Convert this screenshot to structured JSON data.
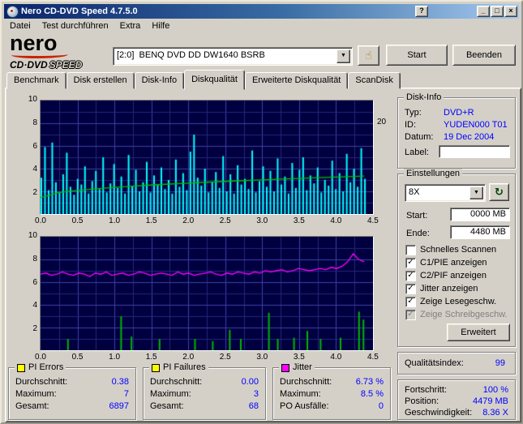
{
  "window": {
    "title": "Nero CD-DVD Speed 4.7.5.0",
    "controls": {
      "help": "?",
      "minimize": "_",
      "maximize": "□",
      "close": "×"
    }
  },
  "menu": {
    "items": [
      "Datei",
      "Test durchführen",
      "Extra",
      "Hilfe"
    ]
  },
  "logo": {
    "brand": "nero",
    "product_left": "CD·DVD",
    "product_right": "SPEED"
  },
  "toolbar": {
    "drive": "[2:0]  BENQ DVD DD DW1640 BSRB",
    "start": "Start",
    "quit": "Beenden"
  },
  "tabs": {
    "items": [
      "Benchmark",
      "Disk erstellen",
      "Disk-Info",
      "Diskqualität",
      "Erweiterte Diskqualität",
      "ScanDisk"
    ],
    "active_index": 3
  },
  "charts": {
    "left_ticks": [
      "10",
      "8",
      "6",
      "4",
      "2"
    ],
    "x_ticks": [
      "0.0",
      "0.5",
      "1.0",
      "1.5",
      "2.0",
      "2.5",
      "3.0",
      "3.5",
      "4.0",
      "4.5"
    ],
    "right_tick": "20",
    "bg": "#000040",
    "grid_minor": "#26267a",
    "grid_major": "#3f3fa8"
  },
  "disk_info": {
    "title": "Disk-Info",
    "rows": [
      {
        "label": "Typ:",
        "value": "DVD+R"
      },
      {
        "label": "ID:",
        "value": "YUDEN000 T01"
      },
      {
        "label": "Datum:",
        "value": "19 Dec 2004"
      }
    ],
    "label_caption": "Label:",
    "label_value": ""
  },
  "settings": {
    "title": "Einstellungen",
    "speed": "8X",
    "start_label": "Start:",
    "start_value": "0000 MB",
    "end_label": "Ende:",
    "end_value": "4480 MB",
    "checkboxes": [
      {
        "label": "Schnelles Scannen",
        "checked": false,
        "enabled": true
      },
      {
        "label": "C1/PIE anzeigen",
        "checked": true,
        "enabled": true
      },
      {
        "label": "C2/PIF anzeigen",
        "checked": true,
        "enabled": true
      },
      {
        "label": "Jitter anzeigen",
        "checked": true,
        "enabled": true
      },
      {
        "label": "Zeige Lesegeschw.",
        "checked": true,
        "enabled": true
      },
      {
        "label": "Zeige Schreibgeschw.",
        "checked": true,
        "enabled": false
      }
    ],
    "advanced_label": "Erweitert"
  },
  "quality": {
    "label": "Qualitätsindex:",
    "value": "99"
  },
  "progress": {
    "rows": [
      {
        "label": "Fortschritt:",
        "value": "100 %"
      },
      {
        "label": "Position:",
        "value": "4479 MB"
      },
      {
        "label": "Geschwindigkeit:",
        "value": "8.36 X"
      }
    ]
  },
  "stats": [
    {
      "title": "PI Errors",
      "color": "#ffff00",
      "rows": [
        [
          "Durchschnitt:",
          "0.38"
        ],
        [
          "Maximum:",
          "7"
        ],
        [
          "Gesamt:",
          "6897"
        ]
      ]
    },
    {
      "title": "PI Failures",
      "color": "#ffff00",
      "rows": [
        [
          "Durchschnitt:",
          "0.00"
        ],
        [
          "Maximum:",
          "3"
        ],
        [
          "Gesamt:",
          "68"
        ]
      ]
    },
    {
      "title": "Jitter",
      "color": "#ff00ff",
      "rows": [
        [
          "Durchschnitt:",
          "6.73 %"
        ],
        [
          "Maximum:",
          "8.5 %"
        ],
        [
          "PO Ausfälle:",
          "0"
        ]
      ]
    }
  ],
  "chart_data": [
    {
      "type": "bar",
      "series": "PI Errors",
      "x_unit": "GB",
      "x_range": [
        0,
        4.5
      ],
      "x_end": 4.38,
      "y_range": [
        0,
        10
      ],
      "bar_color": "#00ffff",
      "values": [
        3.2,
        5.9,
        2.1,
        6.3,
        2.8,
        1.9,
        3.5,
        5.4,
        2.4,
        1.7,
        3.1,
        2.6,
        4.2,
        1.8,
        2.9,
        3.8,
        2.2,
        5.0,
        1.9,
        2.7,
        4.4,
        2.3,
        3.3,
        1.8,
        5.2,
        2.5,
        3.9,
        2.0,
        2.8,
        4.6,
        1.9,
        3.4,
        2.6,
        4.1,
        2.2,
        3.0,
        1.8,
        4.8,
        2.4,
        3.6,
        2.1,
        5.5,
        7.0,
        3.2,
        2.5,
        4.0,
        1.9,
        2.8,
        3.7,
        2.3,
        5.1,
        2.0,
        3.5,
        1.8,
        4.3,
        2.6,
        3.1,
        2.2,
        5.6,
        1.9,
        2.9,
        4.2,
        2.4,
        3.8,
        2.0,
        4.9,
        2.6,
        3.3,
        1.8,
        4.5,
        2.3,
        3.9,
        5.0,
        2.1,
        3.4,
        2.7,
        4.1,
        1.9,
        3.0,
        2.5,
        4.7,
        2.2,
        3.6,
        2.0,
        5.3,
        2.8,
        4.0,
        2.4,
        5.8,
        3.1
      ],
      "overlay_line": {
        "series": "Lesegeschwindigkeit",
        "color": "#00c000",
        "y_range": [
          0,
          25
        ],
        "axis_label": "20",
        "points": [
          [
            0,
            3.6
          ],
          [
            0.25,
            4.74
          ],
          [
            0.5,
            5.21
          ],
          [
            0.75,
            5.57
          ],
          [
            1,
            5.87
          ],
          [
            1.25,
            6.14
          ],
          [
            1.5,
            6.38
          ],
          [
            1.75,
            6.61
          ],
          [
            2,
            6.81
          ],
          [
            2.25,
            7.01
          ],
          [
            2.5,
            7.19
          ],
          [
            2.75,
            7.37
          ],
          [
            3,
            7.54
          ],
          [
            3.25,
            7.7
          ],
          [
            3.5,
            7.85
          ],
          [
            3.75,
            8.0
          ],
          [
            4,
            8.15
          ],
          [
            4.25,
            8.29
          ],
          [
            4.38,
            8.36
          ]
        ]
      }
    },
    {
      "type": "line",
      "series": "Jitter",
      "unit": "%",
      "x_range": [
        0,
        4.5
      ],
      "x_end": 4.38,
      "y_range": [
        0,
        10
      ],
      "line_color": "#ff00ff",
      "values": [
        6.7,
        6.8,
        6.6,
        6.7,
        6.9,
        6.7,
        6.6,
        6.8,
        6.7,
        6.5,
        6.8,
        6.7,
        6.9,
        6.6,
        6.7,
        6.8,
        6.6,
        6.7,
        6.9,
        6.8,
        6.6,
        6.7,
        6.8,
        6.7,
        6.6,
        6.9,
        6.7,
        6.8,
        6.6,
        6.7,
        6.8,
        6.9,
        6.7,
        6.6,
        6.8,
        6.7,
        6.9,
        6.8,
        6.7,
        6.9,
        6.8,
        7.0,
        6.9,
        7.0,
        7.1,
        6.9,
        7.0,
        7.2,
        7.1,
        7.0,
        7.1,
        7.2,
        7.1,
        7.3,
        7.2,
        7.4,
        7.8,
        8.5,
        8.0,
        7.8
      ],
      "overlay_bars": {
        "series": "PI Failures",
        "color": "#00b400",
        "points": [
          [
            0.36,
            1
          ],
          [
            1.08,
            3
          ],
          [
            1.22,
            1.2
          ],
          [
            1.6,
            1
          ],
          [
            2.08,
            1
          ],
          [
            2.32,
            0.8
          ],
          [
            2.55,
            1.8
          ],
          [
            2.7,
            1
          ],
          [
            3.08,
            3.3
          ],
          [
            3.2,
            1
          ],
          [
            3.42,
            1.1
          ],
          [
            3.6,
            1.7
          ],
          [
            3.78,
            1
          ],
          [
            4.05,
            1.1
          ],
          [
            4.3,
            3.4
          ],
          [
            4.36,
            2.7
          ]
        ]
      }
    }
  ]
}
